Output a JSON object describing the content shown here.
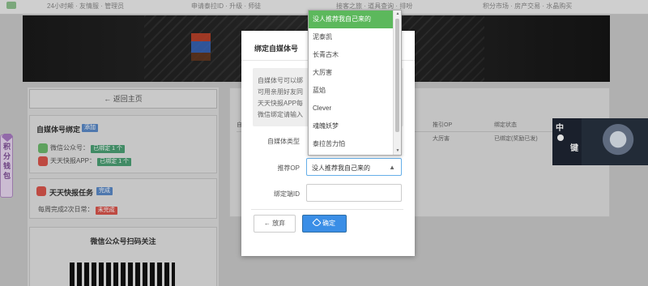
{
  "topnav": {
    "item1": "24小时颠 · 友情服 · 管理员",
    "item2": "申请泰拉ID · 升级 · 师徒",
    "item3": "接客之旅 · 道具查询 · 排吩",
    "item4": "积分市场 · 房产交易 · 水晶购买"
  },
  "left": {
    "back_label": "返回主页",
    "media_title": "自媒体号绑定",
    "media_add": "添加",
    "wechat_label": "微信公众号：",
    "wechat_badge": "已绑定 1 个",
    "app_label": "天天快报APP：",
    "app_badge": "已绑定 1 个",
    "task_title": "天天快报任务",
    "task_badge": "完成",
    "daily_label": "每周完成2次日常：",
    "daily_badge": "未完成",
    "qr_title": "微信公众号扫码关注"
  },
  "right": {
    "col1": "自媒",
    "col2": "推引OP",
    "col3": "绑定状态",
    "row_op": "大厉害",
    "row_status": "已绑定(奖励已发)"
  },
  "float": {
    "vertical_text": "积分钱包"
  },
  "avatar": {
    "char1": "中",
    "char2": "键"
  },
  "modal": {
    "title": "绑定自媒体号",
    "info_lines": [
      "自媒体号可以绑",
      "可用亲朋好友同",
      "天天快报APP每",
      "微信绑定请输入"
    ],
    "type_label": "自媒体类型",
    "op_label": "推荐OP",
    "op_value": "没人推荐我自己来的",
    "id_label": "绑定端ID",
    "id_value": "",
    "cancel_label": "放弃",
    "ok_label": "确定"
  },
  "dropdown": {
    "options": [
      "没人推荐我自己来的",
      "泥泰凯",
      "长青古木",
      "大厉害",
      "蓝焰",
      "Clever",
      "魂魄妖梦",
      "泰拉苦力怕"
    ],
    "selected_index": 0
  },
  "colors": {
    "accent_blue": "#3a8ee6",
    "selected_green": "#5cb85c",
    "badge_green": "#4a9f73",
    "badge_red": "#d9554c"
  }
}
